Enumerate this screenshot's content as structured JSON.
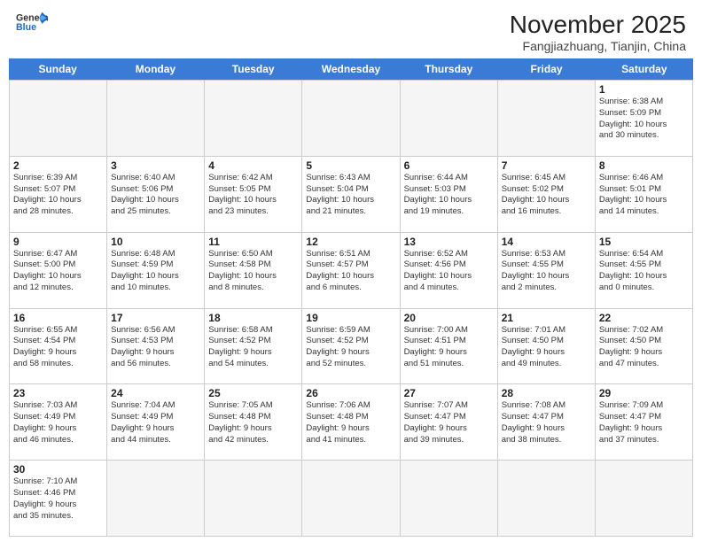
{
  "header": {
    "logo_general": "General",
    "logo_blue": "Blue",
    "month_year": "November 2025",
    "location": "Fangjiazhuang, Tianjin, China"
  },
  "weekdays": [
    "Sunday",
    "Monday",
    "Tuesday",
    "Wednesday",
    "Thursday",
    "Friday",
    "Saturday"
  ],
  "cells": [
    {
      "day": "",
      "empty": true,
      "info": ""
    },
    {
      "day": "",
      "empty": true,
      "info": ""
    },
    {
      "day": "",
      "empty": true,
      "info": ""
    },
    {
      "day": "",
      "empty": true,
      "info": ""
    },
    {
      "day": "",
      "empty": true,
      "info": ""
    },
    {
      "day": "",
      "empty": true,
      "info": ""
    },
    {
      "day": "1",
      "empty": false,
      "info": "Sunrise: 6:38 AM\nSunset: 5:09 PM\nDaylight: 10 hours\nand 30 minutes."
    },
    {
      "day": "2",
      "empty": false,
      "info": "Sunrise: 6:39 AM\nSunset: 5:07 PM\nDaylight: 10 hours\nand 28 minutes."
    },
    {
      "day": "3",
      "empty": false,
      "info": "Sunrise: 6:40 AM\nSunset: 5:06 PM\nDaylight: 10 hours\nand 25 minutes."
    },
    {
      "day": "4",
      "empty": false,
      "info": "Sunrise: 6:42 AM\nSunset: 5:05 PM\nDaylight: 10 hours\nand 23 minutes."
    },
    {
      "day": "5",
      "empty": false,
      "info": "Sunrise: 6:43 AM\nSunset: 5:04 PM\nDaylight: 10 hours\nand 21 minutes."
    },
    {
      "day": "6",
      "empty": false,
      "info": "Sunrise: 6:44 AM\nSunset: 5:03 PM\nDaylight: 10 hours\nand 19 minutes."
    },
    {
      "day": "7",
      "empty": false,
      "info": "Sunrise: 6:45 AM\nSunset: 5:02 PM\nDaylight: 10 hours\nand 16 minutes."
    },
    {
      "day": "8",
      "empty": false,
      "info": "Sunrise: 6:46 AM\nSunset: 5:01 PM\nDaylight: 10 hours\nand 14 minutes."
    },
    {
      "day": "9",
      "empty": false,
      "info": "Sunrise: 6:47 AM\nSunset: 5:00 PM\nDaylight: 10 hours\nand 12 minutes."
    },
    {
      "day": "10",
      "empty": false,
      "info": "Sunrise: 6:48 AM\nSunset: 4:59 PM\nDaylight: 10 hours\nand 10 minutes."
    },
    {
      "day": "11",
      "empty": false,
      "info": "Sunrise: 6:50 AM\nSunset: 4:58 PM\nDaylight: 10 hours\nand 8 minutes."
    },
    {
      "day": "12",
      "empty": false,
      "info": "Sunrise: 6:51 AM\nSunset: 4:57 PM\nDaylight: 10 hours\nand 6 minutes."
    },
    {
      "day": "13",
      "empty": false,
      "info": "Sunrise: 6:52 AM\nSunset: 4:56 PM\nDaylight: 10 hours\nand 4 minutes."
    },
    {
      "day": "14",
      "empty": false,
      "info": "Sunrise: 6:53 AM\nSunset: 4:55 PM\nDaylight: 10 hours\nand 2 minutes."
    },
    {
      "day": "15",
      "empty": false,
      "info": "Sunrise: 6:54 AM\nSunset: 4:55 PM\nDaylight: 10 hours\nand 0 minutes."
    },
    {
      "day": "16",
      "empty": false,
      "info": "Sunrise: 6:55 AM\nSunset: 4:54 PM\nDaylight: 9 hours\nand 58 minutes."
    },
    {
      "day": "17",
      "empty": false,
      "info": "Sunrise: 6:56 AM\nSunset: 4:53 PM\nDaylight: 9 hours\nand 56 minutes."
    },
    {
      "day": "18",
      "empty": false,
      "info": "Sunrise: 6:58 AM\nSunset: 4:52 PM\nDaylight: 9 hours\nand 54 minutes."
    },
    {
      "day": "19",
      "empty": false,
      "info": "Sunrise: 6:59 AM\nSunset: 4:52 PM\nDaylight: 9 hours\nand 52 minutes."
    },
    {
      "day": "20",
      "empty": false,
      "info": "Sunrise: 7:00 AM\nSunset: 4:51 PM\nDaylight: 9 hours\nand 51 minutes."
    },
    {
      "day": "21",
      "empty": false,
      "info": "Sunrise: 7:01 AM\nSunset: 4:50 PM\nDaylight: 9 hours\nand 49 minutes."
    },
    {
      "day": "22",
      "empty": false,
      "info": "Sunrise: 7:02 AM\nSunset: 4:50 PM\nDaylight: 9 hours\nand 47 minutes."
    },
    {
      "day": "23",
      "empty": false,
      "info": "Sunrise: 7:03 AM\nSunset: 4:49 PM\nDaylight: 9 hours\nand 46 minutes."
    },
    {
      "day": "24",
      "empty": false,
      "info": "Sunrise: 7:04 AM\nSunset: 4:49 PM\nDaylight: 9 hours\nand 44 minutes."
    },
    {
      "day": "25",
      "empty": false,
      "info": "Sunrise: 7:05 AM\nSunset: 4:48 PM\nDaylight: 9 hours\nand 42 minutes."
    },
    {
      "day": "26",
      "empty": false,
      "info": "Sunrise: 7:06 AM\nSunset: 4:48 PM\nDaylight: 9 hours\nand 41 minutes."
    },
    {
      "day": "27",
      "empty": false,
      "info": "Sunrise: 7:07 AM\nSunset: 4:47 PM\nDaylight: 9 hours\nand 39 minutes."
    },
    {
      "day": "28",
      "empty": false,
      "info": "Sunrise: 7:08 AM\nSunset: 4:47 PM\nDaylight: 9 hours\nand 38 minutes."
    },
    {
      "day": "29",
      "empty": false,
      "info": "Sunrise: 7:09 AM\nSunset: 4:47 PM\nDaylight: 9 hours\nand 37 minutes."
    },
    {
      "day": "30",
      "empty": false,
      "info": "Sunrise: 7:10 AM\nSunset: 4:46 PM\nDaylight: 9 hours\nand 35 minutes."
    },
    {
      "day": "",
      "empty": true,
      "info": ""
    },
    {
      "day": "",
      "empty": true,
      "info": ""
    },
    {
      "day": "",
      "empty": true,
      "info": ""
    },
    {
      "day": "",
      "empty": true,
      "info": ""
    },
    {
      "day": "",
      "empty": true,
      "info": ""
    },
    {
      "day": "",
      "empty": true,
      "info": ""
    }
  ]
}
